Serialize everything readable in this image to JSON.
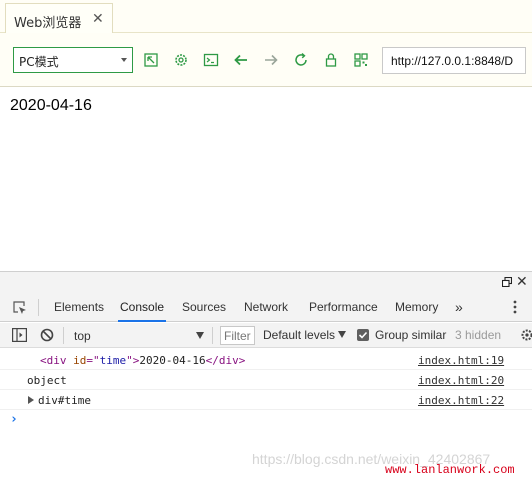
{
  "browser": {
    "tab_title": "Web浏览器",
    "tab_close": "✕",
    "mode_select": {
      "value": "PC模式"
    },
    "url": "http://127.0.0.1:8848/D",
    "accent": "#2e9a45",
    "icons": [
      "open-external-icon",
      "gear-icon",
      "terminal-icon",
      "arrow-left-icon",
      "arrow-right-icon",
      "refresh-icon",
      "lock-icon",
      "qrcode-icon"
    ]
  },
  "page": {
    "time_text": "2020-04-16"
  },
  "devtools": {
    "close": "✕",
    "tabs": [
      {
        "label": "Elements",
        "active": false
      },
      {
        "label": "Console",
        "active": true
      },
      {
        "label": "Sources",
        "active": false
      },
      {
        "label": "Network",
        "active": false
      },
      {
        "label": "Performance",
        "active": false
      },
      {
        "label": "Memory",
        "active": false
      }
    ],
    "more_tabs": "»",
    "context": "top",
    "filter_placeholder": "Filter",
    "levels": "Default levels",
    "group_similar": {
      "label": "Group similar",
      "checked": true
    },
    "hidden_count": "3 hidden",
    "console": {
      "rows": [
        {
          "tag_open": "<div ",
          "attr_name": "id",
          "attr_eq": "=\"",
          "attr_value": "time",
          "attr_close": "\">",
          "text": "2020-04-16",
          "tag_close": "</div>",
          "source": "index.html:19"
        },
        {
          "text": "object",
          "source": "index.html:20"
        },
        {
          "text": "div#time",
          "source": "index.html:22"
        }
      ],
      "prompt": "›"
    }
  },
  "watermark": {
    "csdn": "https://blog.csdn.net/weixin_42402867",
    "site": "www.lanlanwork.com"
  }
}
